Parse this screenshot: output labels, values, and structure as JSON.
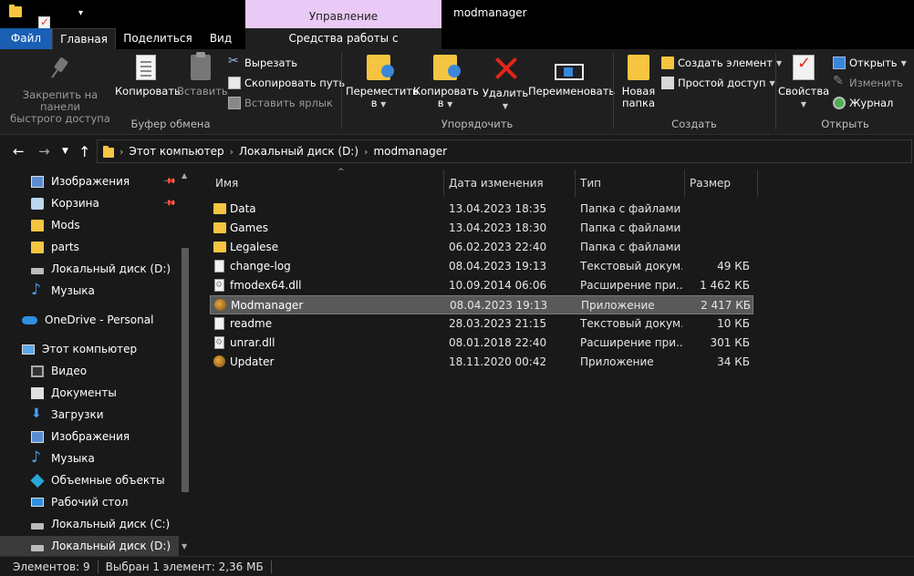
{
  "window": {
    "title": "modmanager",
    "context_tab": "Управление"
  },
  "ribbon_tabs": {
    "file": "Файл",
    "home": "Главная",
    "share": "Поделиться",
    "view": "Вид",
    "app_tools": "Средства работы с приложениями"
  },
  "clipboard": {
    "pin_line1": "Закрепить на панели",
    "pin_line2": "быстрого доступа",
    "copy": "Копировать",
    "paste": "Вставить",
    "cut": "Вырезать",
    "copy_path": "Скопировать путь",
    "paste_shortcut": "Вставить ярлык",
    "label": "Буфер обмена"
  },
  "organize": {
    "move_line1": "Переместить",
    "move_line2": "в",
    "copy_line1": "Копировать",
    "copy_line2": "в",
    "delete": "Удалить",
    "rename": "Переименовать",
    "label": "Упорядочить"
  },
  "create": {
    "new_folder_line1": "Новая",
    "new_folder_line2": "папка",
    "new_item": "Создать элемент",
    "easy_access": "Простой доступ",
    "label": "Создать"
  },
  "open_group": {
    "properties": "Свойства",
    "open": "Открыть",
    "edit": "Изменить",
    "history": "Журнал",
    "label": "Открыть"
  },
  "breadcrumb": [
    "Этот компьютер",
    "Локальный диск (D:)",
    "modmanager"
  ],
  "nav": {
    "pictures_quick": "Изображения",
    "recycle_bin": "Корзина",
    "mods": "Mods",
    "parts": "parts",
    "disk_d_quick": "Локальный диск (D:)",
    "music_quick": "Музыка",
    "onedrive": "OneDrive - Personal",
    "this_pc": "Этот компьютер",
    "video": "Видео",
    "documents": "Документы",
    "downloads": "Загрузки",
    "pictures": "Изображения",
    "music": "Музыка",
    "objects3d": "Объемные объекты",
    "desktop": "Рабочий стол",
    "disk_c": "Локальный диск (C:)",
    "disk_d": "Локальный диск (D:)"
  },
  "columns": {
    "name": "Имя",
    "date": "Дата изменения",
    "type": "Тип",
    "size": "Размер"
  },
  "files": [
    {
      "name": "Data",
      "date": "13.04.2023 18:35",
      "type": "Папка с файлами",
      "size": "",
      "icon": "folder-icon"
    },
    {
      "name": "Games",
      "date": "13.04.2023 18:30",
      "type": "Папка с файлами",
      "size": "",
      "icon": "folder-icon"
    },
    {
      "name": "Legalese",
      "date": "06.02.2023 22:40",
      "type": "Папка с файлами",
      "size": "",
      "icon": "folder-icon"
    },
    {
      "name": "change-log",
      "date": "08.04.2023 19:13",
      "type": "Текстовый докум...",
      "size": "49 КБ",
      "icon": "text-file-icon"
    },
    {
      "name": "fmodex64.dll",
      "date": "10.09.2014 06:06",
      "type": "Расширение при...",
      "size": "1 462 КБ",
      "icon": "dll-file-icon"
    },
    {
      "name": "Modmanager",
      "date": "08.04.2023 19:13",
      "type": "Приложение",
      "size": "2 417 КБ",
      "icon": "app-icon"
    },
    {
      "name": "readme",
      "date": "28.03.2023 21:15",
      "type": "Текстовый докум...",
      "size": "10 КБ",
      "icon": "text-file-icon"
    },
    {
      "name": "unrar.dll",
      "date": "08.01.2018 22:40",
      "type": "Расширение при...",
      "size": "301 КБ",
      "icon": "dll-file-icon"
    },
    {
      "name": "Updater",
      "date": "18.11.2020 00:42",
      "type": "Приложение",
      "size": "34 КБ",
      "icon": "app-icon"
    }
  ],
  "status": {
    "count": "Элементов: 9",
    "selected": "Выбран 1 элемент: 2,36 МБ"
  },
  "colors": {
    "file_tab": "#1a5fb4",
    "context_tab": "#e9c9f5",
    "background": "#191919",
    "selected_row": "#595959"
  }
}
